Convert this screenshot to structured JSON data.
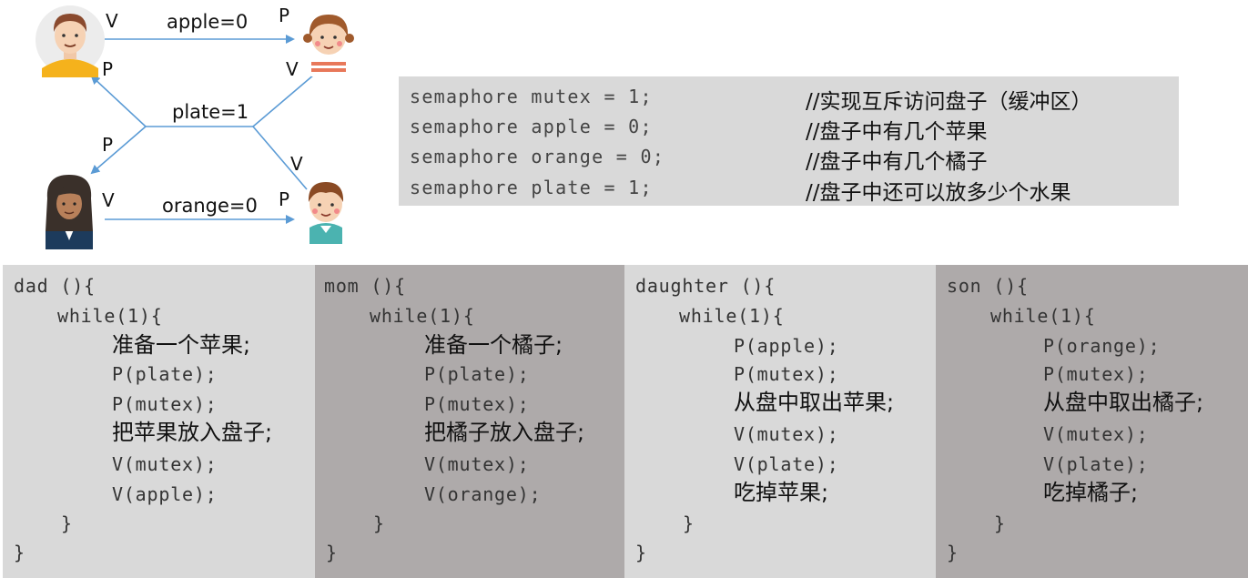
{
  "diagram": {
    "edges": {
      "apple": "apple=0",
      "plate": "plate=1",
      "orange": "orange=0"
    },
    "pv": {
      "dad_v": "V",
      "dad_p": "P",
      "daughter_p": "P",
      "daughter_v": "V",
      "mom_p": "P",
      "mom_v": "V",
      "son_v": "V",
      "son_p": "P"
    }
  },
  "declarations": [
    {
      "code": "semaphore mutex = 1;",
      "comment": "//实现互斥访问盘子（缓冲区）"
    },
    {
      "code": "semaphore apple = 0;",
      "comment": "//盘子中有几个苹果"
    },
    {
      "code": "semaphore orange = 0;",
      "comment": "//盘子中有几个橘子"
    },
    {
      "code": "semaphore plate = 1;",
      "comment": "//盘子中还可以放多少个水果"
    }
  ],
  "panels": {
    "dad": {
      "header": "dad (){",
      "while": "while(1){",
      "lines": [
        "准备一个苹果;",
        "P(plate);",
        "P(mutex);",
        "把苹果放入盘子;",
        "V(mutex);",
        "V(apple);"
      ],
      "close_inner": "}",
      "close_outer": "}"
    },
    "mom": {
      "header": "mom (){",
      "while": "while(1){",
      "lines": [
        "准备一个橘子;",
        "P(plate);",
        "P(mutex);",
        "把橘子放入盘子;",
        "V(mutex);",
        "V(orange);"
      ],
      "close_inner": "}",
      "close_outer": "}"
    },
    "daughter": {
      "header": "daughter (){",
      "while": "while(1){",
      "lines": [
        "P(apple);",
        "P(mutex);",
        "从盘中取出苹果;",
        "V(mutex);",
        "V(plate);",
        "吃掉苹果;"
      ],
      "close_inner": "}",
      "close_outer": "}"
    },
    "son": {
      "header": "son (){",
      "while": "while(1){",
      "lines": [
        "P(orange);",
        "P(mutex);",
        "从盘中取出橘子;",
        "V(mutex);",
        "V(plate);",
        "吃掉橘子;"
      ],
      "close_inner": "}",
      "close_outer": "}"
    }
  }
}
